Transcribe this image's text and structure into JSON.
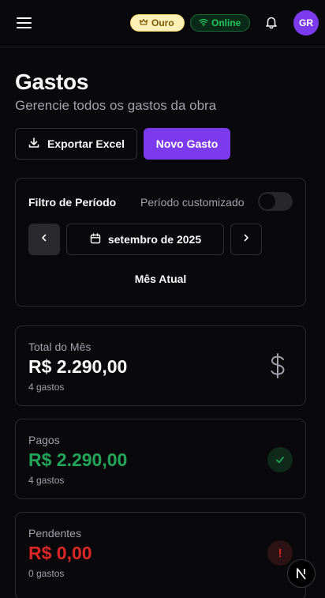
{
  "header": {
    "tier_badge": "Ouro",
    "status_badge": "Online",
    "avatar_initials": "GR"
  },
  "page": {
    "title": "Gastos",
    "subtitle": "Gerencie todos os gastos da obra"
  },
  "actions": {
    "export_label": "Exportar Excel",
    "new_label": "Novo Gasto"
  },
  "filter": {
    "title": "Filtro de Período",
    "custom_label": "Período customizado",
    "custom_enabled": false,
    "month_label": "setembro de 2025",
    "current_label": "Mês Atual"
  },
  "stats": [
    {
      "label": "Total do Mês",
      "value": "R$ 2.290,00",
      "count": "4 gastos",
      "color": "#fafafa",
      "icon": "dollar-icon"
    },
    {
      "label": "Pagos",
      "value": "R$ 2.290,00",
      "count": "4 gastos",
      "color": "#22a559",
      "icon": "check-icon"
    },
    {
      "label": "Pendentes",
      "value": "R$ 0,00",
      "count": "0 gastos",
      "color": "#dc2626",
      "icon": "alert-icon"
    }
  ],
  "colors": {
    "accent": "#7c3aed",
    "background": "#09090b",
    "success": "#22a559",
    "danger": "#dc2626",
    "tier": "#fdf1b8"
  }
}
